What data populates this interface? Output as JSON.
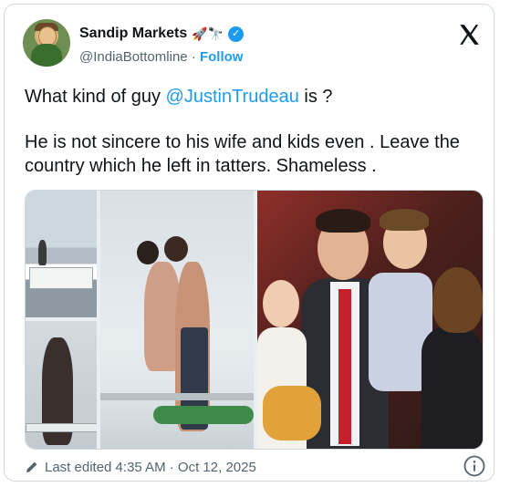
{
  "author": {
    "name": "Sandip Markets",
    "emoji": "🚀🔭",
    "handle": "@IndiaBottomline",
    "separator": "·",
    "follow_label": "Follow"
  },
  "tweet": {
    "line1_prefix": "What kind of guy ",
    "line1_mention": "@JustinTrudeau",
    "line1_suffix": " is ?",
    "paragraph2": "He is not sincere to his wife and kids even . Leave the country which he left in tatters. Shameless ."
  },
  "media": {
    "count": 4
  },
  "footer": {
    "edited_label": "Last edited 4:35 AM · Oct 12, 2025"
  },
  "icons": {
    "verified": "verified-badge-icon",
    "platform": "x-logo-icon",
    "edit": "pencil-icon",
    "info": "info-icon"
  },
  "colors": {
    "accent": "#1d9bf0",
    "text": "#0f1419",
    "muted": "#536471",
    "border": "#cfd9de"
  }
}
